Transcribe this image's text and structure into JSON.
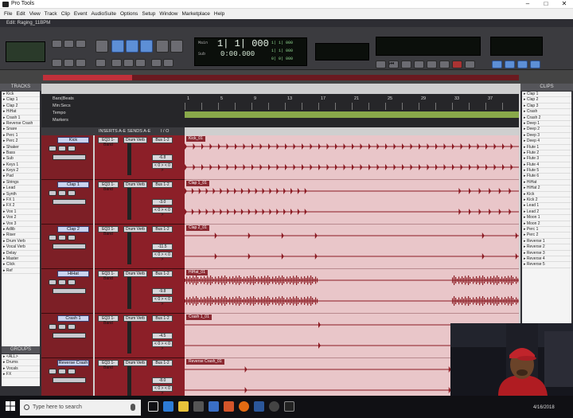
{
  "window": {
    "title": "Pro Tools"
  },
  "menu": [
    "File",
    "Edit",
    "View",
    "Track",
    "Clip",
    "Event",
    "AudioSuite",
    "Options",
    "Setup",
    "Window",
    "Marketplace",
    "Help"
  ],
  "edit_window": {
    "title": "Edit: Raging_11BPM"
  },
  "counter": {
    "main": "1| 1| 000",
    "sub": "0:00.000",
    "start": "1| 1| 000",
    "end": "1| 1| 000",
    "length": "0| 0| 000",
    "label_main": "Main",
    "label_sub": "Sub"
  },
  "panels": {
    "tracks": "TRACKS",
    "groups": "GROUPS",
    "clips": "CLIPS",
    "all_group": "<ALL>"
  },
  "ruler_labels": [
    "Bars|Beats",
    "Min:Secs",
    "Tempo",
    "Markers"
  ],
  "bar_numbers": [
    "1",
    "5",
    "9",
    "13",
    "17",
    "21",
    "25",
    "29",
    "33",
    "37"
  ],
  "column_headers": {
    "inserts": "INSERTS A-E",
    "sends": "SENDS A-E",
    "io": "I / O"
  },
  "tracks": [
    {
      "name": "Kick",
      "clip": "Kick_01",
      "insert": "EQ3 1-Band",
      "send": "Drum Verb",
      "io": "Bus 1-2",
      "vol": "-6.8",
      "pan": "< 0 > < 0 >"
    },
    {
      "name": "Clap 1",
      "clip": "Clap 1_01",
      "insert": "EQ3 1-Band",
      "send": "Drum Verb",
      "io": "Bus 1-2",
      "vol": "-3.0",
      "pan": "< 0 > < 0 >"
    },
    {
      "name": "Clap 2",
      "clip": "Clap 2_01",
      "insert": "EQ3 1-Band",
      "send": "Drum Verb",
      "io": "Bus 1-2",
      "vol": "-11.5",
      "pan": "< 0 > < 0 >"
    },
    {
      "name": "HiHat",
      "clip": "HiHat_01",
      "insert": "EQ3 1-Band",
      "send": "Drum Verb",
      "io": "Bus 1-2",
      "vol": "-9.8",
      "pan": "< 0 > < 0 >"
    },
    {
      "name": "Crash 1",
      "clip": "Crash 1_01",
      "insert": "EQ3 1-Band",
      "send": "Drum Verb",
      "io": "Bus 1-2",
      "vol": "-4.5",
      "pan": "< 0 > < 0 >"
    },
    {
      "name": "Reverse Crash",
      "clip": "Reverse Crash_01",
      "insert": "EQ3 1-Band",
      "send": "Drum Verb",
      "io": "Bus 1-2",
      "vol": "-8.0",
      "pan": "< 0 > < 0 >"
    }
  ],
  "track_list": [
    "Kick",
    "Clap 1",
    "Clap 2",
    "HiHat",
    "Crash 1",
    "Reverse Crash",
    "Snare",
    "Perc 1",
    "Perc 2",
    "Shaker",
    "Bass",
    "Sub",
    "Keys 1",
    "Keys 2",
    "Pad",
    "Strings",
    "Lead",
    "Synth",
    "FX 1",
    "FX 2",
    "Vox 1",
    "Vox 2",
    "Vox 3",
    "Adlib",
    "Riser",
    "Drum Verb",
    "Vocal Verb",
    "Delay",
    "Master",
    "Click",
    "Ref"
  ],
  "group_list": [
    "<ALL>",
    "Drums",
    "Vocals",
    "FX"
  ],
  "clip_list": [
    "Clap 1",
    "Clap 2",
    "Clap 3",
    "Crash",
    "Crash 2",
    "Deep 1",
    "Deep 2",
    "Deep 3",
    "Deep 4",
    "Flute 1",
    "Flute 2",
    "Flute 3",
    "Flute 4",
    "Flute 5",
    "Flute 6",
    "HiHat",
    "HiHat 2",
    "Kick",
    "Kick 2",
    "Lead 1",
    "Lead 2",
    "Moon 1",
    "Moon 2",
    "Perc 1",
    "Perc 2",
    "Reverse 1",
    "Reverse 2",
    "Reverse 3",
    "Reverse 4",
    "Reverse 5"
  ],
  "search": {
    "placeholder": "Type here to search"
  },
  "clock": {
    "time": "4/16/2018"
  },
  "colors": {
    "track_red": "#7d1f26",
    "lane_pink": "#e9c6c9",
    "waveform": "#8b1a22",
    "marker_green": "#89a94a"
  }
}
